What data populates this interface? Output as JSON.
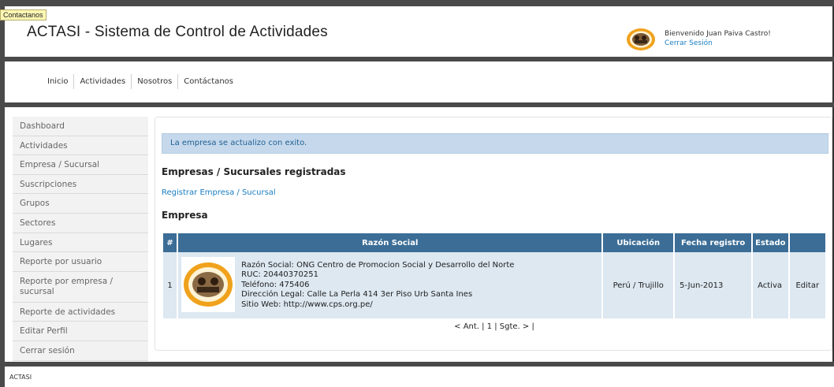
{
  "header": {
    "title": "ACTASI - Sistema de Control de Actividades",
    "tooltip": "Contactanos",
    "welcome": "Bienvenido Juan Paiva Castro!",
    "logout": "Cerrar Sesión"
  },
  "nav": {
    "items": [
      {
        "label": "Inicio"
      },
      {
        "label": "Actividades"
      },
      {
        "label": "Nosotros"
      },
      {
        "label": "Contáctanos"
      }
    ]
  },
  "sidebar": {
    "items": [
      {
        "label": "Dashboard"
      },
      {
        "label": "Actividades"
      },
      {
        "label": "Empresa / Sucursal"
      },
      {
        "label": "Suscripciones"
      },
      {
        "label": "Grupos"
      },
      {
        "label": "Sectores"
      },
      {
        "label": "Lugares"
      },
      {
        "label": "Reporte por usuario"
      },
      {
        "label": "Reporte por empresa / sucursal"
      },
      {
        "label": "Reporte de actividades"
      },
      {
        "label": "Editar Perfil"
      },
      {
        "label": "Cerrar sesión"
      }
    ]
  },
  "main": {
    "alert": "La empresa se actualizo con exito.",
    "section_title": "Empresas / Sucursales registradas",
    "register_link": "Registrar Empresa / Sucursal",
    "sub_title": "Empresa",
    "table": {
      "headers": [
        "#",
        "Razón Social",
        "Ubicación",
        "Fecha registro",
        "Estado",
        ""
      ],
      "rows": [
        {
          "num": "1",
          "razon": "Razón Social: ONG Centro de Promocion Social y Desarrollo del Norte",
          "ruc": "RUC: 20440370251",
          "telefono": "Teléfono: 475406",
          "direccion": "Dirección Legal: Calle La Perla 414 3er Piso Urb Santa Ines",
          "web": "Sitio Web: http://www.cps.org.pe/",
          "ubicacion": "Perú / Trujillo",
          "fecha": "5-Jun-2013",
          "estado": "Activa",
          "accion": "Editar"
        }
      ]
    },
    "pagination": "< Ant. | 1 | Sgte. > |"
  },
  "footer": {
    "text": "ACTASI"
  },
  "colors": {
    "accent": "#1a7dc2",
    "table_header": "#3b6d96",
    "row_bg": "#dde8f1",
    "alert_bg": "#c6d9ec"
  }
}
